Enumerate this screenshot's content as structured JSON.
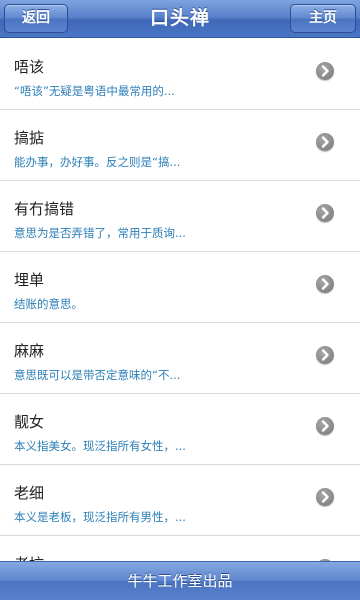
{
  "header": {
    "title": "口头禅",
    "back_label": "返回",
    "home_label": "主页"
  },
  "list": {
    "items": [
      {
        "title": "唔该",
        "desc": "“唔该”无疑是粤语中最常用的...",
        "icon": "chevron-right-icon"
      },
      {
        "title": "搞掂",
        "desc": "能办事，办好事。反之则是“搞...",
        "icon": "chevron-right-icon"
      },
      {
        "title": "有冇搞错",
        "desc": "意思为是否弄错了，常用于质询...",
        "icon": "chevron-right-icon"
      },
      {
        "title": "埋单",
        "desc": "结账的意思。",
        "icon": "chevron-right-icon"
      },
      {
        "title": "麻麻",
        "desc": "意思既可以是带否定意味的“不...",
        "icon": "chevron-right-icon"
      },
      {
        "title": "靓女",
        "desc": "本义指美女。现泛指所有女性，...",
        "icon": "chevron-right-icon"
      },
      {
        "title": "老细",
        "desc": "本义是老板，现泛指所有男性，...",
        "icon": "chevron-right-icon"
      },
      {
        "title": "老坑",
        "desc": "",
        "icon": "chevron-right-icon"
      }
    ]
  },
  "footer": {
    "text": "牛牛工作室出品"
  },
  "colors": {
    "nav_blue": "#5a82cc",
    "desc_blue": "#2c7fb8",
    "chevron_gray": "#8c8c8c"
  }
}
